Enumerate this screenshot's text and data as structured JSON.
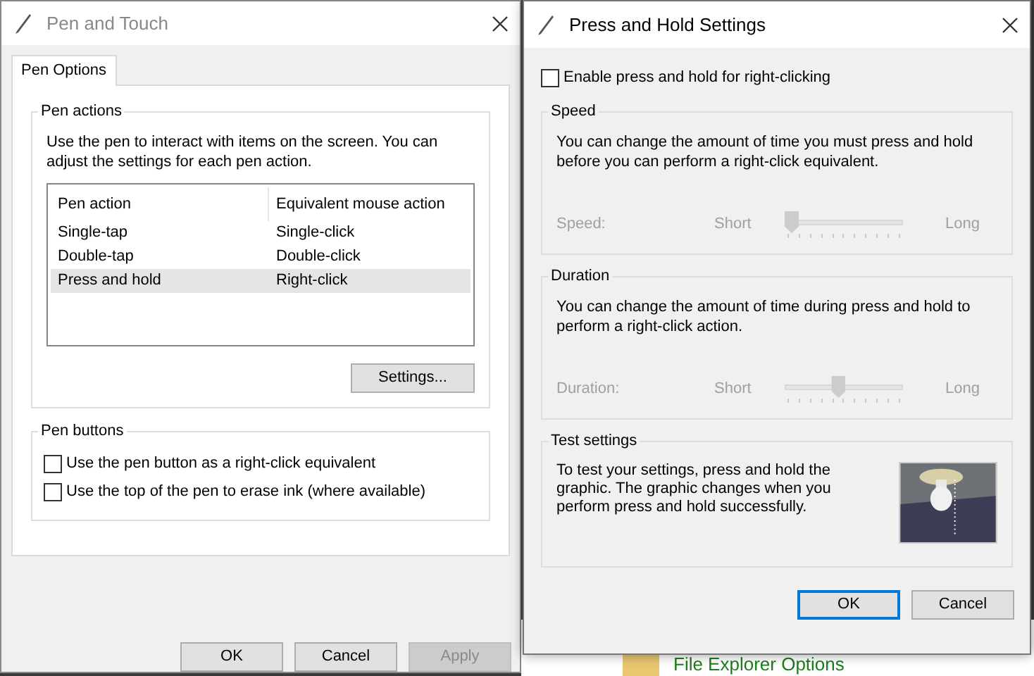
{
  "background": {
    "item_label": "File Explorer Options"
  },
  "pen_and_touch": {
    "title": "Pen and Touch",
    "tabs": [
      {
        "label": "Pen Options",
        "selected": true
      }
    ],
    "pen_actions": {
      "legend": "Pen actions",
      "description": "Use the pen to interact with items on the screen.  You can adjust the settings for each pen action.",
      "columns": [
        "Pen action",
        "Equivalent mouse action"
      ],
      "rows": [
        {
          "cells": [
            "Single-tap",
            "Single-click"
          ],
          "selected": false
        },
        {
          "cells": [
            "Double-tap",
            "Double-click"
          ],
          "selected": false
        },
        {
          "cells": [
            "Press and hold",
            "Right-click"
          ],
          "selected": true
        }
      ],
      "settings_button": "Settings..."
    },
    "pen_buttons": {
      "legend": "Pen buttons",
      "options": [
        {
          "label": "Use the pen button as a right-click equivalent",
          "checked": false
        },
        {
          "label": "Use the top of the pen to erase ink (where available)",
          "checked": false
        }
      ]
    },
    "buttons": [
      {
        "label": "OK",
        "disabled": false
      },
      {
        "label": "Cancel",
        "disabled": false
      },
      {
        "label": "Apply",
        "disabled": true
      }
    ]
  },
  "press_and_hold": {
    "title": "Press and Hold Settings",
    "enable": {
      "label": "Enable press and hold for right-clicking",
      "checked": false
    },
    "sliders": [
      {
        "legend": "Speed",
        "description": "You can change the amount of time you must press and hold before you can perform a right-click equivalent.",
        "label": "Speed:",
        "min_label": "Short",
        "max_label": "Long",
        "level": 0,
        "disabled": true
      },
      {
        "legend": "Duration",
        "description": "You can change the amount of time during press and hold to perform a right-click action.",
        "label": "Duration:",
        "min_label": "Short",
        "max_label": "Long",
        "level": 0.45,
        "disabled": true
      }
    ],
    "test": {
      "legend": "Test settings",
      "description": "To test your settings, press and hold the graphic. The graphic changes when you perform press and hold successfully."
    },
    "buttons": [
      {
        "label": "OK",
        "default": true
      },
      {
        "label": "Cancel",
        "default": false
      }
    ]
  }
}
